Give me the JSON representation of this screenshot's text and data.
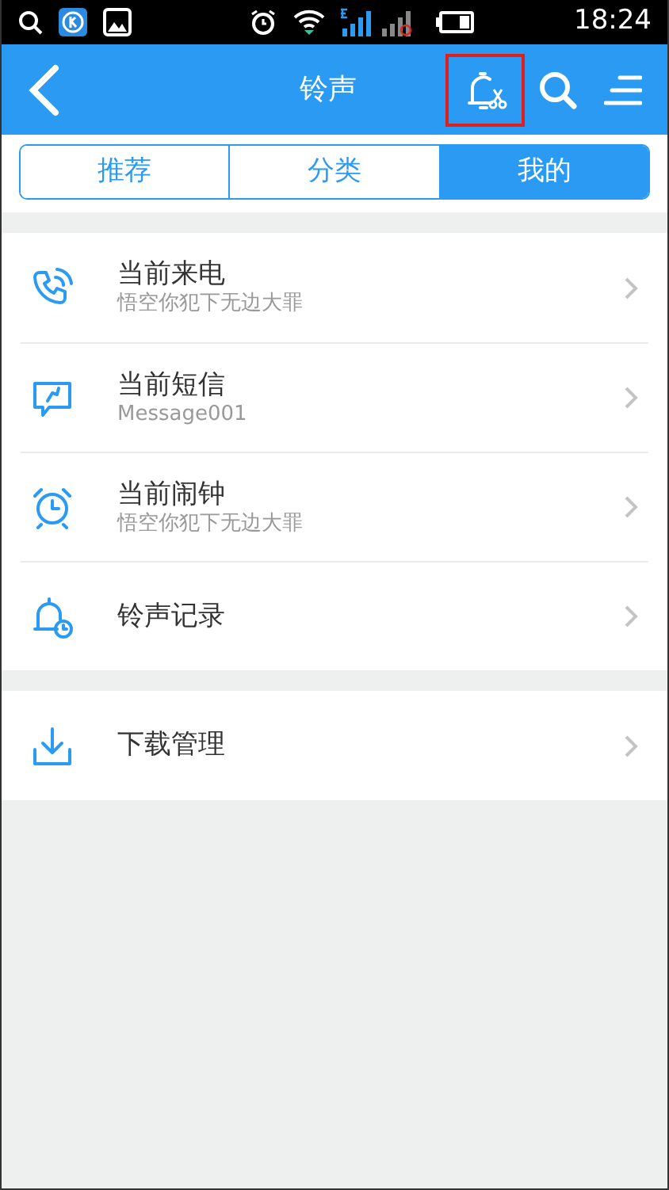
{
  "status_bar": {
    "time": "18:24"
  },
  "header": {
    "title": "铃声",
    "ringtone_button_highlighted": true
  },
  "tabs": [
    {
      "label": "推荐",
      "selected": false
    },
    {
      "label": "分类",
      "selected": false
    },
    {
      "label": "我的",
      "selected": true
    }
  ],
  "sections": [
    {
      "items": [
        {
          "kind": "phone",
          "title": "当前来电",
          "subtitle": "悟空你犯下无边大罪"
        },
        {
          "kind": "message",
          "title": "当前短信",
          "subtitle": "Message001"
        },
        {
          "kind": "alarm",
          "title": "当前闹钟",
          "subtitle": "悟空你犯下无边大罪"
        },
        {
          "kind": "bell",
          "title": "铃声记录"
        }
      ]
    },
    {
      "items": [
        {
          "kind": "download",
          "title": "下载管理"
        }
      ]
    }
  ]
}
